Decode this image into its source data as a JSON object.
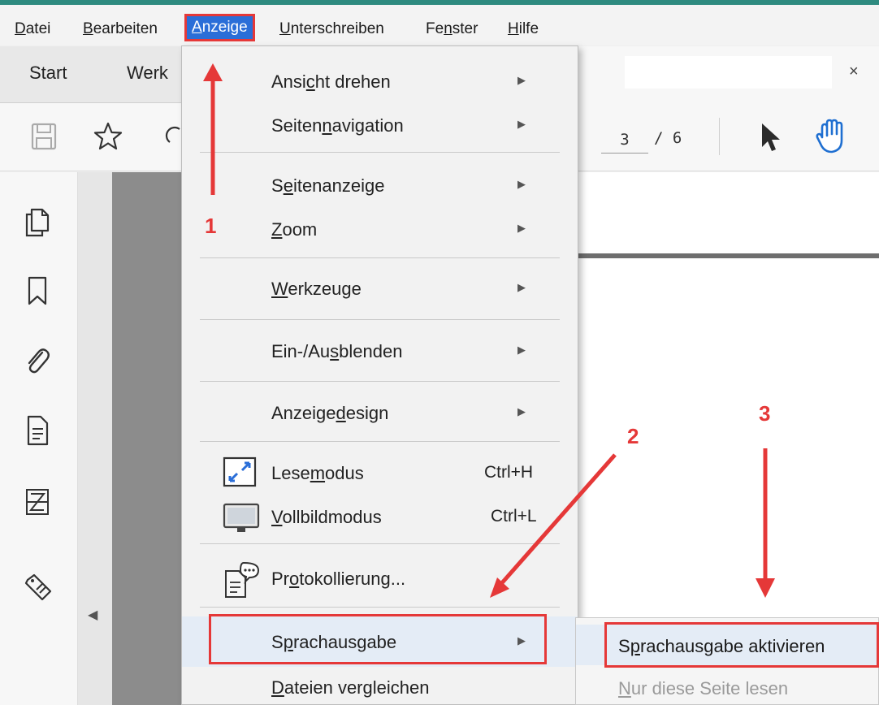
{
  "menubar": {
    "items": [
      {
        "label": "Datei",
        "key": "D",
        "rest": "atei"
      },
      {
        "label": "Bearbeiten",
        "key": "B",
        "rest": "earbeiten"
      },
      {
        "label": "Anzeige",
        "key": "A",
        "rest": "nzeige"
      },
      {
        "label": "Unterschreiben",
        "key": "U",
        "rest": "nterschreiben"
      },
      {
        "label": "Fenster",
        "pre": "Fe",
        "key": "n",
        "rest": "ster"
      },
      {
        "label": "Hilfe",
        "key": "H",
        "rest": "ilfe"
      }
    ]
  },
  "tabs": {
    "start": "Start",
    "werkzeuge_partial": "Werk",
    "close": "×"
  },
  "toolbar": {
    "page_current": "3",
    "page_total": "/ 6"
  },
  "menu": {
    "items": [
      {
        "pre": "Ansi",
        "key": "c",
        "rest": "ht drehen",
        "submenu": true
      },
      {
        "pre": "Seiten",
        "key": "n",
        "rest": "avigation",
        "submenu": true
      },
      {
        "pre": "S",
        "key": "e",
        "rest": "itenanzeige",
        "submenu": true
      },
      {
        "pre": "",
        "key": "Z",
        "rest": "oom",
        "submenu": true
      },
      {
        "pre": "",
        "key": "W",
        "rest": "erkzeuge",
        "submenu": true
      },
      {
        "pre": "Ein-/Au",
        "key": "s",
        "rest": "blenden",
        "submenu": true
      },
      {
        "pre": "Anzeige",
        "key": "d",
        "rest": "esign",
        "submenu": true
      },
      {
        "pre": "Lese",
        "key": "m",
        "rest": "odus",
        "shortcut": "Ctrl+H",
        "icon": "read-mode-icon"
      },
      {
        "pre": "",
        "key": "V",
        "rest": "ollbildmodus",
        "shortcut": "Ctrl+L",
        "icon": "fullscreen-icon"
      },
      {
        "pre": "Pr",
        "key": "o",
        "rest": "tokollierung...",
        "icon": "log-icon"
      },
      {
        "pre": "S",
        "key": "p",
        "rest": "rachausgabe",
        "submenu": true
      },
      {
        "pre": "",
        "key": "D",
        "rest": "ateien vergleichen"
      }
    ],
    "arrow": "▶"
  },
  "submenu": {
    "items": [
      {
        "pre": "S",
        "key": "p",
        "rest": "rachausgabe aktivieren",
        "enabled": true
      },
      {
        "pre": "",
        "key": "N",
        "rest": "ur diese Seite lesen",
        "enabled": false
      }
    ]
  },
  "annotations": {
    "step1": "1",
    "step2": "2",
    "step3": "3",
    "color": "#e53838"
  },
  "colors": {
    "accent_stripe": "#2e8a7f",
    "menu_highlight": "#2a6ed8",
    "annotation_red": "#e53838"
  }
}
